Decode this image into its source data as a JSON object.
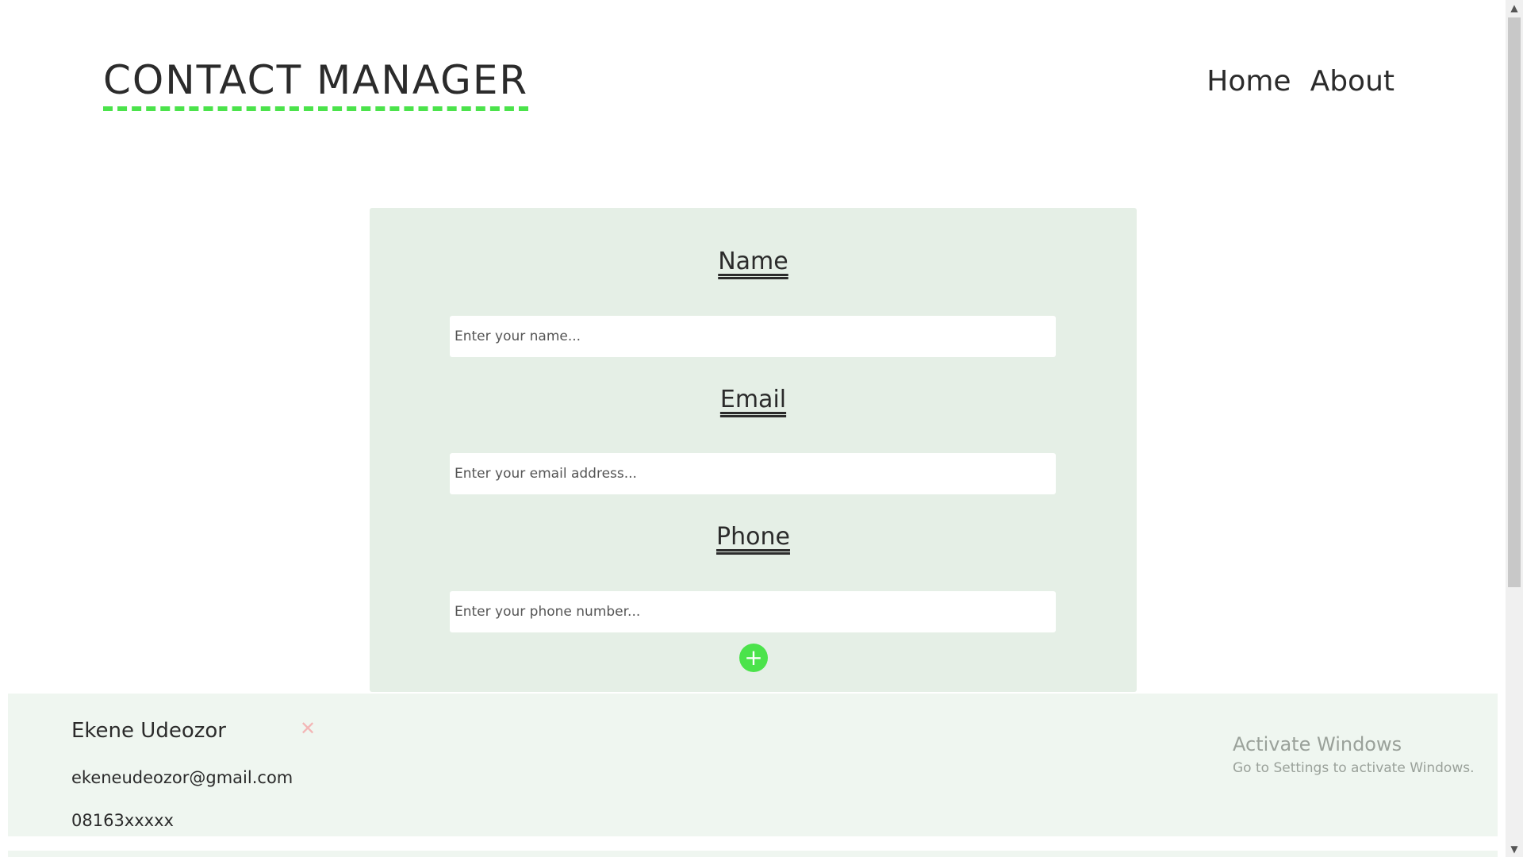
{
  "header": {
    "title": "CONTACT MANAGER",
    "nav": {
      "home": "Home",
      "about": "About"
    }
  },
  "form": {
    "name_label": "Name",
    "name_placeholder": "Enter your name...",
    "email_label": "Email",
    "email_placeholder": "Enter your email address...",
    "phone_label": "Phone",
    "phone_placeholder": "Enter your phone number...",
    "add_button": "+"
  },
  "contacts": [
    {
      "name": "Ekene Udeozor",
      "email": "ekeneudeozor@gmail.com",
      "phone": "08163xxxxx",
      "delete": "✕"
    }
  ],
  "watermark": {
    "title": "Activate Windows",
    "subtitle": "Go to Settings to activate Windows."
  },
  "scrollbar": {
    "up": "▲",
    "down": "▼"
  },
  "colors": {
    "accent": "#4be34b",
    "card": "#e5efe6",
    "list": "#eff6f0",
    "delete": "#f3b6b6"
  }
}
